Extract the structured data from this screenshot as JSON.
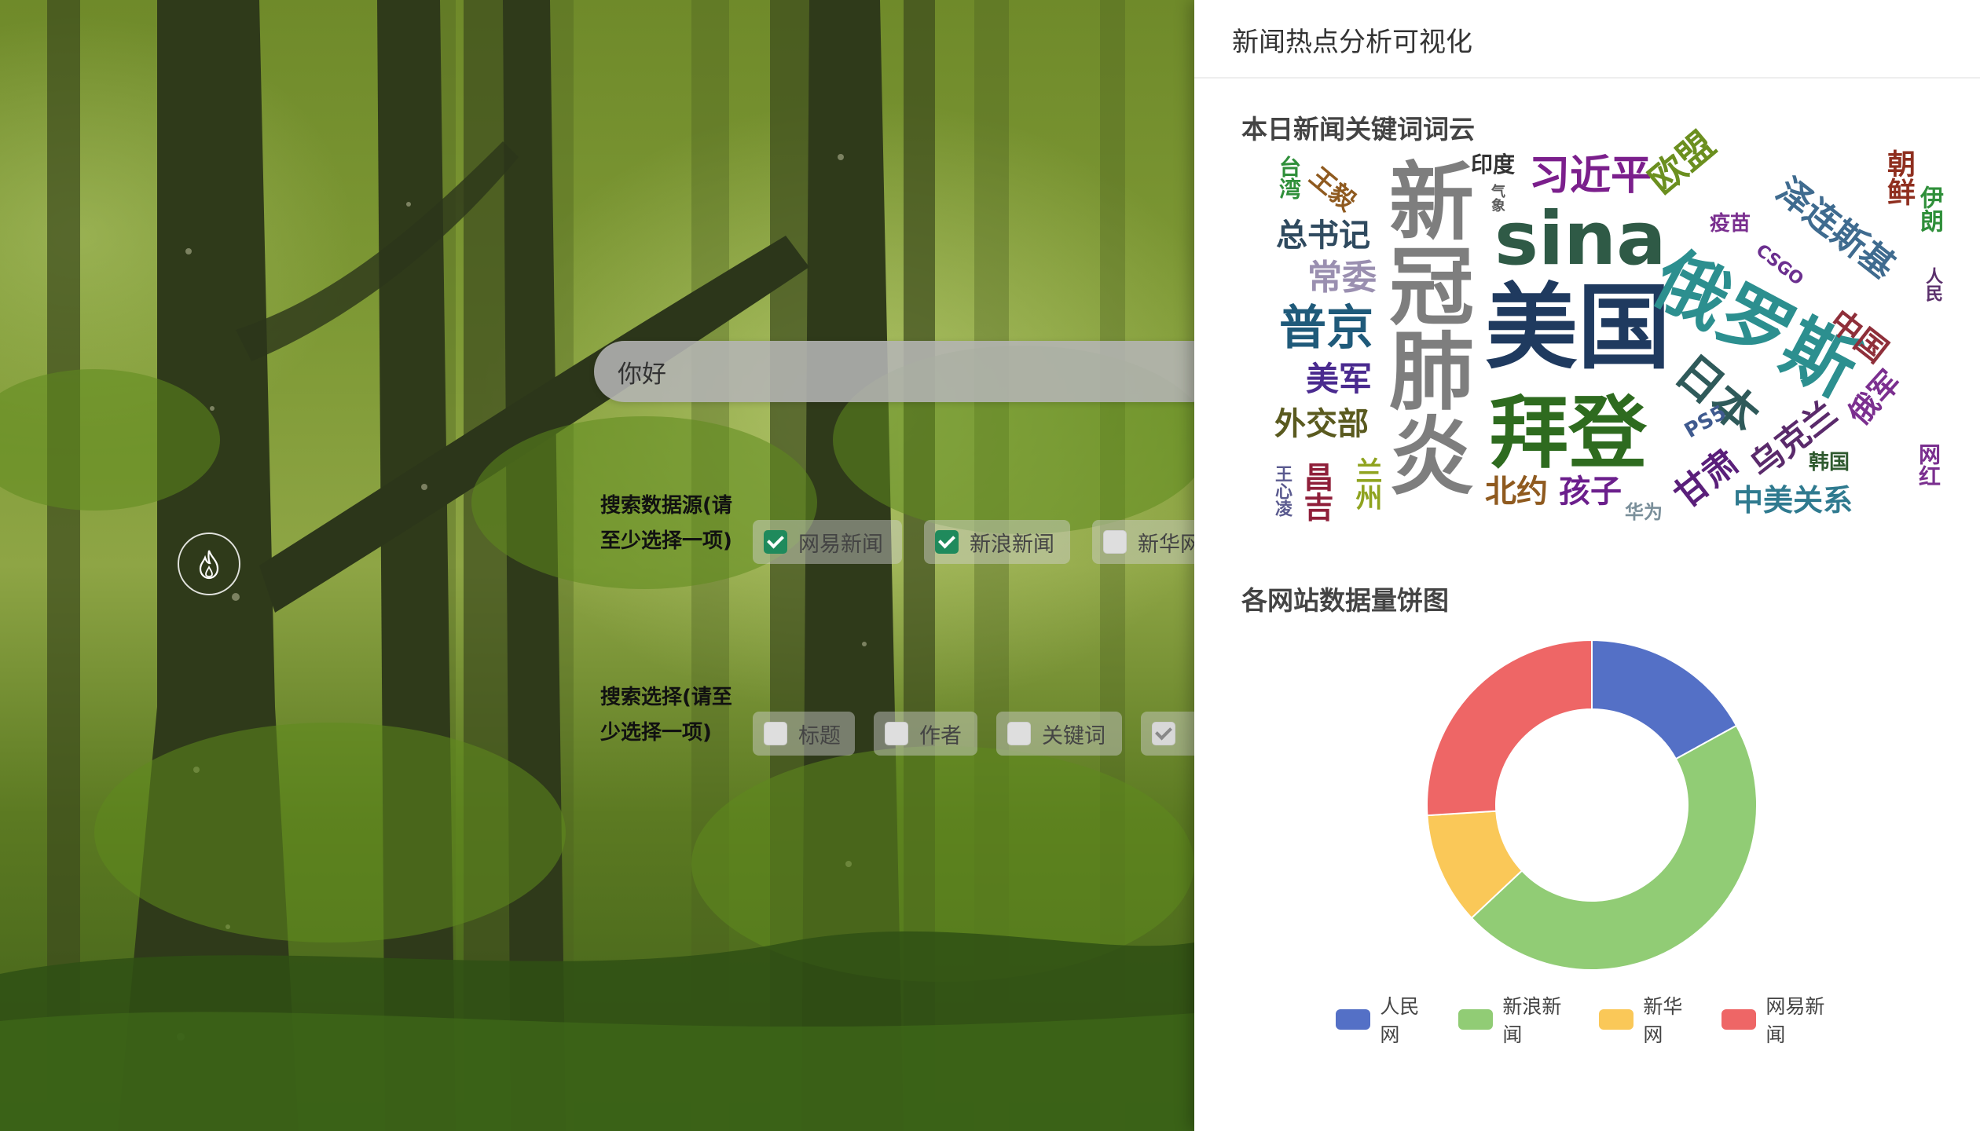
{
  "search": {
    "value": "你好"
  },
  "source_group": {
    "label": "搜索数据源(请至少选择一项)",
    "options": [
      {
        "label": "网易新闻",
        "checked": true
      },
      {
        "label": "新浪新闻",
        "checked": true
      },
      {
        "label": "新华网",
        "checked": false
      }
    ]
  },
  "field_group": {
    "label": "搜索选择(请至少选择一项)",
    "options": [
      {
        "label": "标题",
        "checked": false
      },
      {
        "label": "作者",
        "checked": false
      },
      {
        "label": "关键词",
        "checked": false
      },
      {
        "label": "",
        "checked": true
      }
    ]
  },
  "panel": {
    "title": "新闻热点分析可视化",
    "wordcloud_title": "本日新闻关键词词云",
    "pie_title": "各网站数据量饼图"
  },
  "wordcloud": [
    {
      "text": "美国",
      "color": "#1f3a5f"
    },
    {
      "text": "sina",
      "color": "#2f5a46"
    },
    {
      "text": "新冠肺炎",
      "color": "#7e7e7e"
    },
    {
      "text": "俄罗斯",
      "color": "#2c8f8f"
    },
    {
      "text": "拜登",
      "color": "#2e6b1f"
    },
    {
      "text": "习近平",
      "color": "#7b1f8c"
    },
    {
      "text": "日本",
      "color": "#2f5a5a"
    },
    {
      "text": "普京",
      "color": "#1f5a7a"
    },
    {
      "text": "外交部",
      "color": "#5a5a1f"
    },
    {
      "text": "总书记",
      "color": "#2f4a5f"
    },
    {
      "text": "常委",
      "color": "#9a8fb0"
    },
    {
      "text": "美军",
      "color": "#4a2a8f"
    },
    {
      "text": "欧盟",
      "color": "#6b8f1f"
    },
    {
      "text": "泽连斯基",
      "color": "#3f6b8f"
    },
    {
      "text": "中国",
      "color": "#8f2f3a"
    },
    {
      "text": "俄军",
      "color": "#7b2f8f"
    },
    {
      "text": "乌克兰",
      "color": "#5a2a6b"
    },
    {
      "text": "北约",
      "color": "#8f5a1f"
    },
    {
      "text": "孩子",
      "color": "#6b1f8c"
    },
    {
      "text": "中美关系",
      "color": "#2f7a8f"
    },
    {
      "text": "甘肃",
      "color": "#5a1f7a"
    },
    {
      "text": "王毅",
      "color": "#8f5a1f"
    },
    {
      "text": "台湾",
      "color": "#2f8f3a"
    },
    {
      "text": "印度",
      "color": "#333333"
    },
    {
      "text": "疫苗",
      "color": "#7a2f8f"
    },
    {
      "text": "CSGO",
      "color": "#6b2f8f"
    },
    {
      "text": "韩国",
      "color": "#2f5a2f"
    },
    {
      "text": "PS5",
      "color": "#3f5a8f"
    },
    {
      "text": "华为",
      "color": "#7a8f9a"
    },
    {
      "text": "兰州",
      "color": "#8fa31f"
    },
    {
      "text": "昌吉",
      "color": "#8f1f3a"
    },
    {
      "text": "王心凌",
      "color": "#5a5a8f"
    },
    {
      "text": "朝鲜",
      "color": "#8f2f1f"
    },
    {
      "text": "伊朗",
      "color": "#2f8f3a"
    },
    {
      "text": "网红",
      "color": "#7a2f8f"
    },
    {
      "text": "人民",
      "color": "#5a2f6b"
    },
    {
      "text": "气象",
      "color": "#5a5a5a"
    }
  ],
  "chart_data": {
    "type": "pie",
    "title": "各网站数据量饼图",
    "donut": true,
    "categories": [
      "人民网",
      "新浪新闻",
      "新华网",
      "网易新闻"
    ],
    "values": [
      17,
      46,
      11,
      26
    ],
    "colors": [
      "#5470c6",
      "#91cc75",
      "#fac858",
      "#ee6666"
    ],
    "legend": "bottom"
  }
}
